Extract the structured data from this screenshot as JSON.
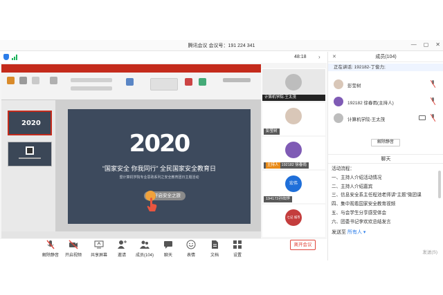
{
  "window": {
    "title": "腾讯会议 会议号：191 224 341",
    "minimize": "—",
    "maximize": "▢",
    "close": "✕"
  },
  "meeting": {
    "timer": "48:18",
    "collapse_glyph": "›"
  },
  "slide": {
    "year": "2020",
    "headline": "“国家安全 你我同行”  全民国家安全教育日",
    "subtitle": "暨计算机学院专业思政系列之安全教育团日主题活动",
    "button_label": "开启安全之旅"
  },
  "tiles": [
    {
      "name": "计算机学院-王太茂",
      "active": true,
      "avatar_color": "#bdbdbd"
    },
    {
      "name": "彭莹树",
      "active": false,
      "avatar_color": "#d9c7b8"
    },
    {
      "name": "192182 徐春雨",
      "active": false,
      "avatar_color": "#7f5bb5",
      "host_badge": "主持人"
    },
    {
      "name": "194172孙炫烨",
      "active": false,
      "avatar_color": "#1f6fd9",
      "avatar_text": "宏伟"
    },
    {
      "name": "",
      "active": false,
      "avatar_color": "#c43d3d",
      "avatar_text": "七记 城市"
    }
  ],
  "toolbar": {
    "buttons": [
      {
        "label": "解除静音"
      },
      {
        "label": "开启视频"
      },
      {
        "label": "共享屏幕"
      },
      {
        "label": "邀请"
      },
      {
        "label": "成员(104)"
      },
      {
        "label": "聊天"
      },
      {
        "label": "表情"
      },
      {
        "label": "文档"
      },
      {
        "label": "设置"
      }
    ],
    "leave_label": "离开会议"
  },
  "members_panel": {
    "title": "成员(104)",
    "close_glyph": "✕",
    "speaking": "正在讲话: 192182-丁俊力;",
    "members": [
      {
        "name": "彭莹树",
        "role": "",
        "avatar_color": "#d9c7b8"
      },
      {
        "name": "192182 徐春雨",
        "role": "(主持人)",
        "avatar_color": "#7f5bb5"
      },
      {
        "name": "计算机学院-王太茂",
        "role": "",
        "avatar_color": "#bdbdbd"
      }
    ],
    "mute_all_label": "解除静音"
  },
  "chat_panel": {
    "title": "聊天",
    "messages": [
      "活动流程：",
      "一、主持人介绍活动情况",
      "二、主持人介绍嘉宾",
      "三、信息安全系主任程池老师讲“主题”微团课",
      "四、集中观看国家安全教育视频",
      "五、与会学生分享感受体会",
      "六、团委书记李欢欢总结发言"
    ],
    "send_to_label": "发送至",
    "send_to_target": "所有人",
    "send_to_caret": "▾",
    "send_button": "发送(S)"
  },
  "colors": {
    "accent": "#2b7de9",
    "danger": "#e0443a",
    "ppt_red": "#c42b1c",
    "slide_bg": "#3d4a5d"
  }
}
